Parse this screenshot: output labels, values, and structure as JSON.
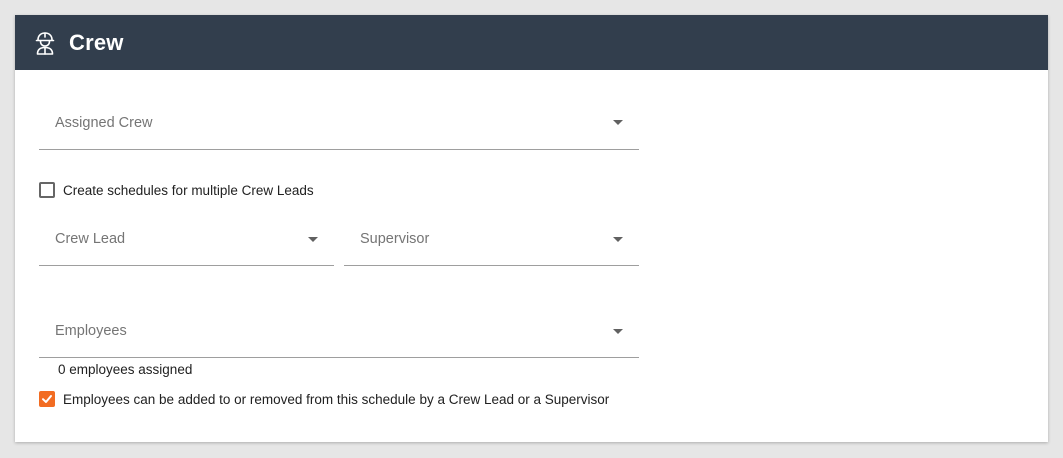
{
  "header": {
    "title": "Crew",
    "icon": "construction-worker-icon"
  },
  "colors": {
    "header_bg": "#323e4d",
    "accent": "#f26c22"
  },
  "form": {
    "assigned_crew": {
      "placeholder": "Assigned Crew",
      "value": ""
    },
    "multiple_crew_leads": {
      "label": "Create schedules for multiple Crew Leads",
      "checked": false
    },
    "crew_lead": {
      "placeholder": "Crew Lead",
      "value": ""
    },
    "supervisor": {
      "placeholder": "Supervisor",
      "value": ""
    },
    "employees": {
      "placeholder": "Employees",
      "value": "",
      "helper": "0 employees assigned"
    },
    "allow_edit": {
      "label": "Employees can be added to or removed from this schedule by a Crew Lead or a Supervisor",
      "checked": true
    }
  }
}
